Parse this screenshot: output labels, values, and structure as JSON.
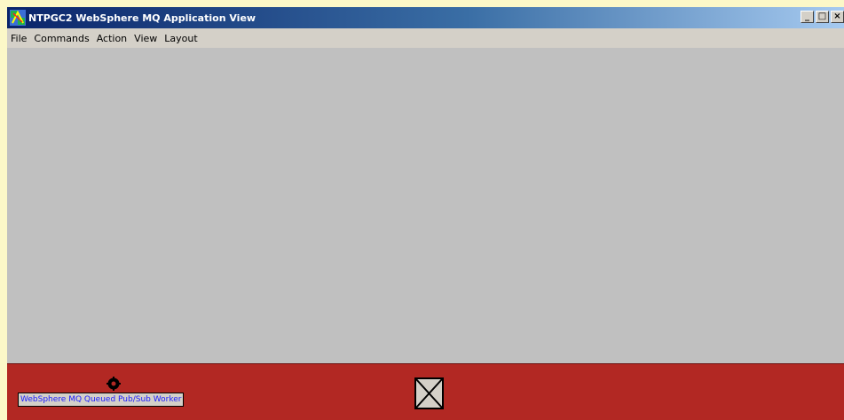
{
  "window": {
    "title": "NTPGC2 WebSphere MQ Application View",
    "controls": {
      "minimize": "_",
      "maximize": "□",
      "close": "×"
    }
  },
  "menubar": {
    "items": [
      {
        "label": "File"
      },
      {
        "label": "Commands"
      },
      {
        "label": "Action"
      },
      {
        "label": "View"
      },
      {
        "label": "Layout"
      }
    ]
  },
  "bottom_panel": {
    "worker_label": "WebSphere MQ Queued Pub/Sub Worker"
  },
  "colors": {
    "titlebar_start": "#0a246a",
    "titlebar_end": "#a6caf0",
    "canvas": "#c0c0c0",
    "bottom_panel": "#b22823",
    "worker_label_text": "#1a1aff"
  },
  "icons": {
    "app": "mq-app-icon",
    "worker": "gear-node-icon",
    "broken": "broken-node-icon"
  }
}
